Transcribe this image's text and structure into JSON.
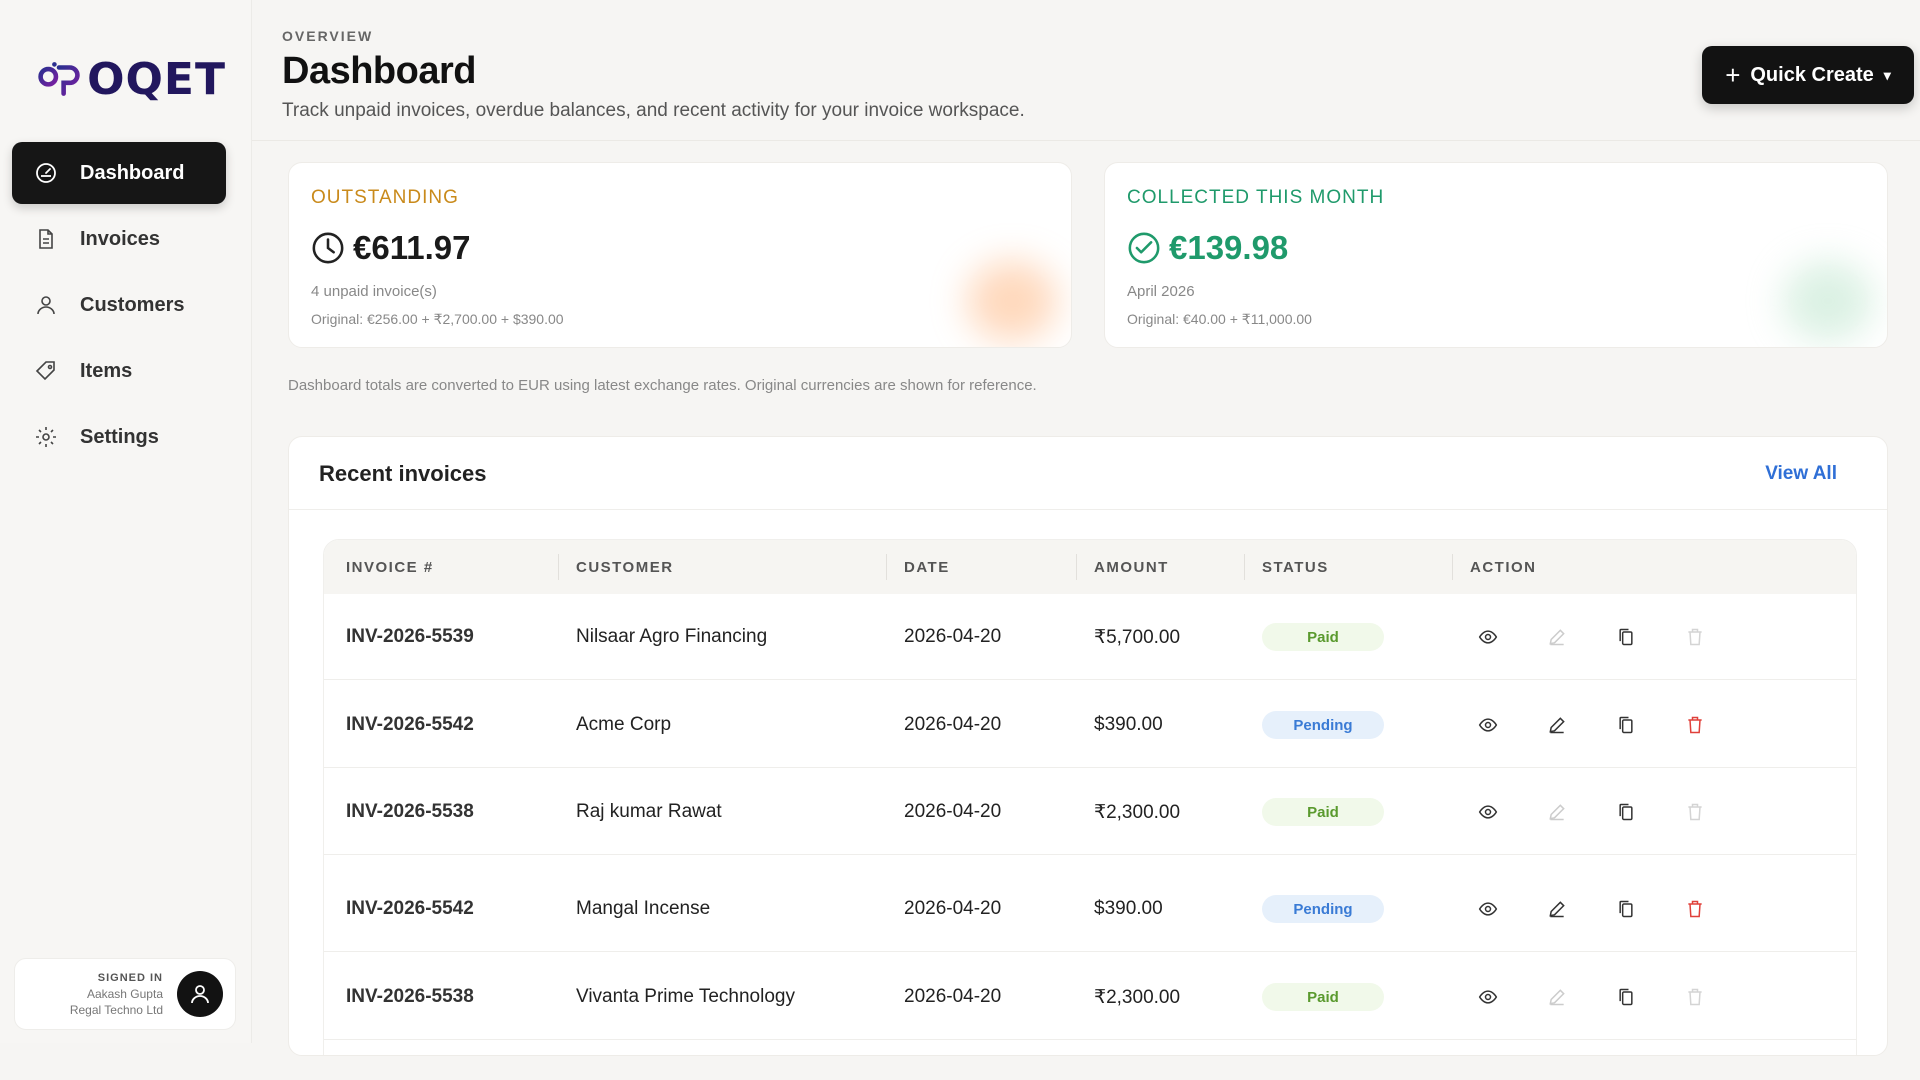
{
  "brand": {
    "logo_text": "OQET"
  },
  "sidebar": {
    "items": [
      {
        "label": "Dashboard",
        "icon": "dashboard-icon",
        "active": true
      },
      {
        "label": "Invoices",
        "icon": "document-icon",
        "active": false
      },
      {
        "label": "Customers",
        "icon": "user-icon",
        "active": false
      },
      {
        "label": "Items",
        "icon": "tag-icon",
        "active": false
      },
      {
        "label": "Settings",
        "icon": "gear-icon",
        "active": false
      }
    ],
    "user": {
      "signed_in_label": "SIGNED IN",
      "name": "Aakash Gupta",
      "org": "Regal Techno Ltd"
    }
  },
  "header": {
    "eyebrow": "OVERVIEW",
    "title": "Dashboard",
    "subtitle": "Track unpaid invoices, overdue balances, and recent activity for your invoice workspace.",
    "quick_create": "Quick Create"
  },
  "stats": {
    "outstanding": {
      "label": "OUTSTANDING",
      "value": "€611.97",
      "sub": "4 unpaid invoice(s)",
      "original": "Original: €256.00 + ₹2,700.00 + $390.00",
      "color": "#c98a1b"
    },
    "collected": {
      "label": "COLLECTED THIS MONTH",
      "value": "€139.98",
      "sub": "April 2026",
      "original": "Original: €40.00 + ₹11,000.00",
      "color": "#1f9a6b"
    }
  },
  "note": "Dashboard totals are converted to EUR using latest exchange rates. Original currencies are shown for reference.",
  "recent": {
    "title": "Recent invoices",
    "view_all": "View All",
    "columns": [
      "INVOICE #",
      "CUSTOMER",
      "DATE",
      "AMOUNT",
      "STATUS",
      "ACTION"
    ],
    "rows": [
      {
        "invoice": "INV-2026-5539",
        "customer": "Nilsaar Agro Financing",
        "date": "2026-04-20",
        "amount": "₹5,700.00",
        "status": "Paid"
      },
      {
        "invoice": "INV-2026-5542",
        "customer": "Acme Corp",
        "date": "2026-04-20",
        "amount": "$390.00",
        "status": "Pending"
      },
      {
        "invoice": "INV-2026-5538",
        "customer": "Raj kumar Rawat",
        "date": "2026-04-20",
        "amount": "₹2,300.00",
        "status": "Paid"
      },
      {
        "invoice": "INV-2026-5542",
        "customer": "Mangal Incense",
        "date": "2026-04-20",
        "amount": "$390.00",
        "status": "Pending"
      },
      {
        "invoice": "INV-2026-5538",
        "customer": "Vivanta Prime Technology",
        "date": "2026-04-20",
        "amount": "₹2,300.00",
        "status": "Paid"
      }
    ]
  }
}
